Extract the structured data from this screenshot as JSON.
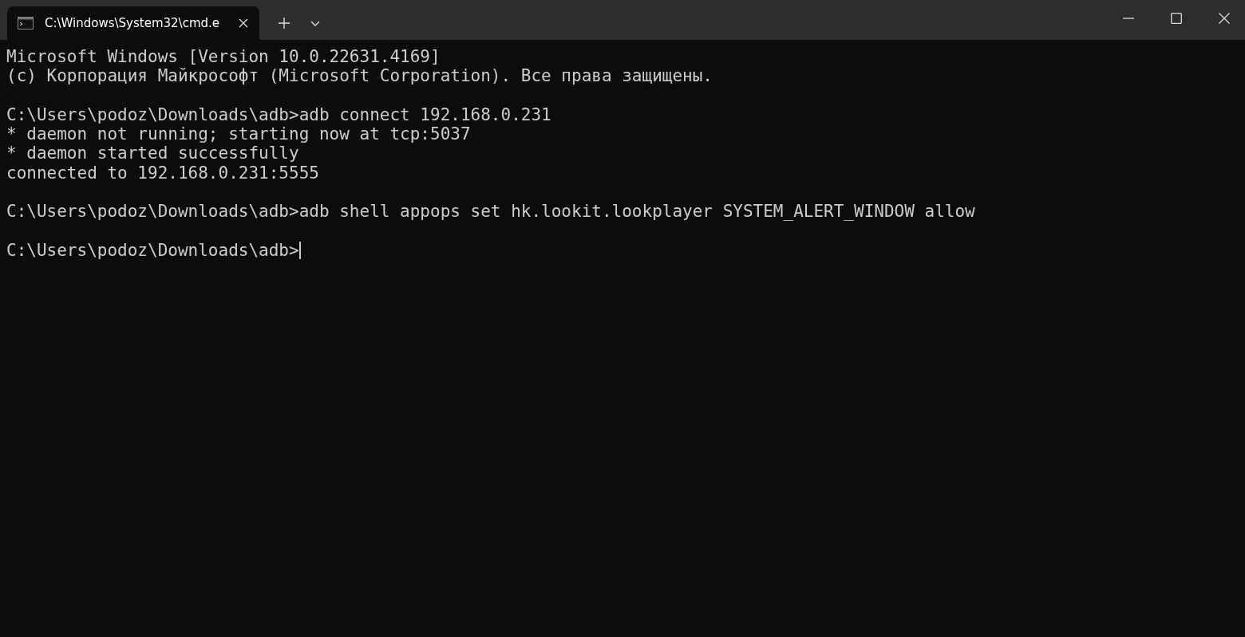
{
  "tabs": [
    {
      "title": "C:\\Windows\\System32\\cmd.e",
      "selected": true
    }
  ],
  "terminal": {
    "blocks": [
      [
        "Microsoft Windows [Version 10.0.22631.4169]",
        "(c) Корпорация Майкрософт (Microsoft Corporation). Все права защищены."
      ],
      [
        "C:\\Users\\podoz\\Downloads\\adb>adb connect 192.168.0.231",
        "* daemon not running; starting now at tcp:5037",
        "* daemon started successfully",
        "connected to 192.168.0.231:5555"
      ],
      [
        "C:\\Users\\podoz\\Downloads\\adb>adb shell appops set hk.lookit.lookplayer SYSTEM_ALERT_WINDOW allow"
      ]
    ],
    "prompt": "C:\\Users\\podoz\\Downloads\\adb>",
    "cursor_visible": true
  }
}
